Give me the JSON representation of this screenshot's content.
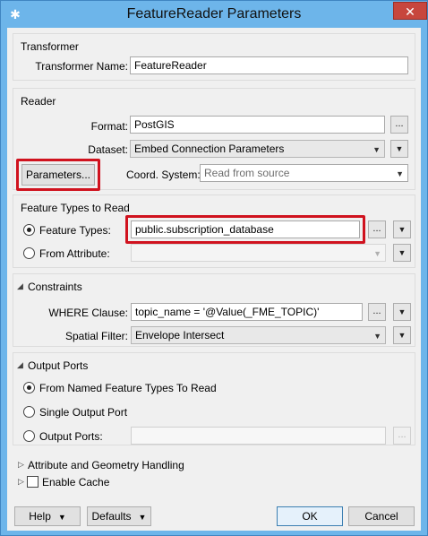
{
  "window": {
    "title": "FeatureReader Parameters",
    "app_icon": "fme-transformer-icon",
    "close_glyph": "✕"
  },
  "transformer": {
    "group_title": "Transformer",
    "name_label": "Transformer Name:",
    "name_value": "FeatureReader"
  },
  "reader": {
    "group_title": "Reader",
    "format_label": "Format:",
    "format_value": "PostGIS",
    "dataset_label": "Dataset:",
    "dataset_value": "Embed Connection Parameters",
    "parameters_button": "Parameters...",
    "coord_label": "Coord. System:",
    "coord_value": "Read from source"
  },
  "feature_types": {
    "group_title": "Feature Types to Read",
    "feature_types_label": "Feature Types:",
    "feature_types_value": "public.subscription_database",
    "from_attribute_label": "From Attribute:",
    "from_attribute_value": ""
  },
  "constraints": {
    "group_title": "Constraints",
    "where_label": "WHERE Clause:",
    "where_value": "topic_name = '@Value(_FME_TOPIC)'",
    "spatial_label": "Spatial Filter:",
    "spatial_value": "Envelope Intersect"
  },
  "output_ports": {
    "group_title": "Output Ports",
    "opt_named": "From Named Feature Types To Read",
    "opt_single": "Single Output Port",
    "opt_ports": "Output Ports:",
    "ports_value": ""
  },
  "sections": {
    "attr_geom": "Attribute and Geometry Handling",
    "cache": "Enable Cache"
  },
  "footer": {
    "help": "Help",
    "defaults": "Defaults",
    "ok": "OK",
    "cancel": "Cancel"
  },
  "glyphs": {
    "ellipsis": "...",
    "dropdown": "▼",
    "caret_down": "◢",
    "caret_right": "▷"
  },
  "colors": {
    "highlight": "#d0121e",
    "title_bar": "#6db5ea",
    "close_button": "#c7463d"
  }
}
